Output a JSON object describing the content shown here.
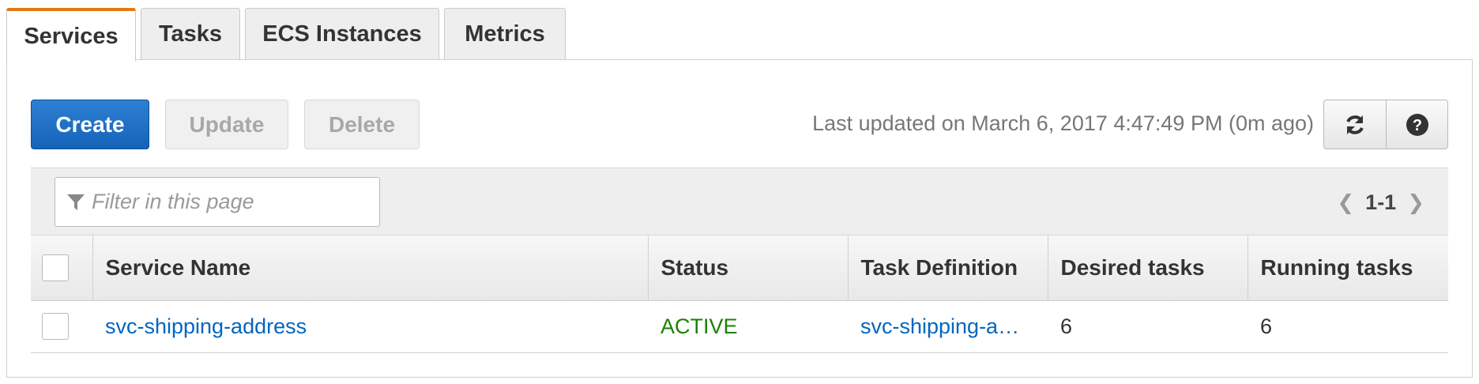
{
  "tabs": [
    {
      "label": "Services",
      "active": true
    },
    {
      "label": "Tasks",
      "active": false
    },
    {
      "label": "ECS Instances",
      "active": false
    },
    {
      "label": "Metrics",
      "active": false
    }
  ],
  "toolbar": {
    "create_label": "Create",
    "update_label": "Update",
    "delete_label": "Delete",
    "last_updated": "Last updated on March 6, 2017 4:47:49 PM (0m ago)",
    "refresh_icon": "refresh-icon",
    "help_icon": "help-icon"
  },
  "filter": {
    "placeholder": "Filter in this page",
    "icon": "filter-icon"
  },
  "pagination": {
    "range": "1-1"
  },
  "table": {
    "columns": [
      "Service Name",
      "Status",
      "Task Definition",
      "Desired tasks",
      "Running tasks"
    ],
    "rows": [
      {
        "service_name": "svc-shipping-address",
        "status": "ACTIVE",
        "task_definition": "svc-shipping-a…",
        "desired_tasks": "6",
        "running_tasks": "6"
      }
    ]
  },
  "colors": {
    "accent_tab": "#e47911",
    "primary_button": "#1f72c7",
    "link": "#0066c0",
    "status_active": "#1d8102"
  }
}
